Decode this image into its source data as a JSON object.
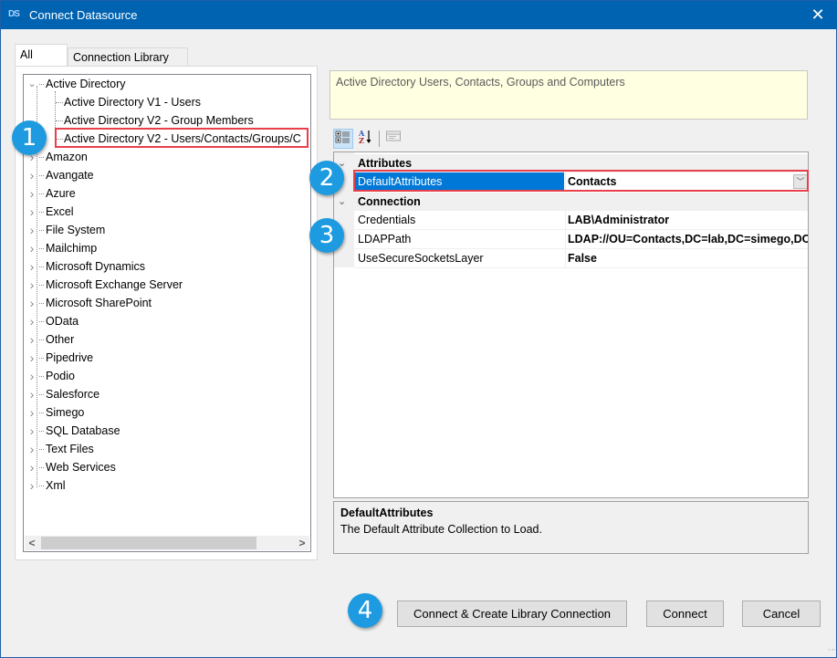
{
  "window": {
    "title": "Connect Datasource",
    "app_icon": "datasync-icon",
    "close_label": "✕"
  },
  "tabs": [
    {
      "label": "All",
      "active": true
    },
    {
      "label": "Connection Library",
      "active": false
    }
  ],
  "tree": {
    "nodes": [
      {
        "label": "Active Directory",
        "expanded": true,
        "children": [
          {
            "label": "Active Directory V1 - Users"
          },
          {
            "label": "Active Directory V2 - Group Members"
          },
          {
            "label": "Active Directory V2 - Users/Contacts/Groups/C",
            "selected": true
          }
        ]
      },
      {
        "label": "Amazon",
        "expanded": false
      },
      {
        "label": "Avangate",
        "expanded": false
      },
      {
        "label": "Azure",
        "expanded": false
      },
      {
        "label": "Excel",
        "expanded": false
      },
      {
        "label": "File System",
        "expanded": false
      },
      {
        "label": "Mailchimp",
        "expanded": false
      },
      {
        "label": "Microsoft Dynamics",
        "expanded": false
      },
      {
        "label": "Microsoft Exchange Server",
        "expanded": false
      },
      {
        "label": "Microsoft SharePoint",
        "expanded": false
      },
      {
        "label": "OData",
        "expanded": false
      },
      {
        "label": "Other",
        "expanded": false
      },
      {
        "label": "Pipedrive",
        "expanded": false
      },
      {
        "label": "Podio",
        "expanded": false
      },
      {
        "label": "Salesforce",
        "expanded": false
      },
      {
        "label": "Simego",
        "expanded": false
      },
      {
        "label": "SQL Database",
        "expanded": false
      },
      {
        "label": "Text Files",
        "expanded": false
      },
      {
        "label": "Web Services",
        "expanded": false
      },
      {
        "label": "Xml",
        "expanded": false
      }
    ],
    "scroll_left_label": "<",
    "scroll_right_label": ">"
  },
  "description": "Active Directory Users, Contacts, Groups and Computers",
  "property_toolbar": {
    "categorized_icon": "categorized-icon",
    "alphabetical_icon": "sort-az-icon",
    "property_pages_icon": "property-pages-icon"
  },
  "property_grid": {
    "categories": [
      {
        "name": "Attributes",
        "properties": [
          {
            "name": "DefaultAttributes",
            "value": "Contacts",
            "selected": true,
            "dropdown": true
          }
        ]
      },
      {
        "name": "Connection",
        "properties": [
          {
            "name": "Credentials",
            "value": "LAB\\Administrator"
          },
          {
            "name": "LDAPPath",
            "value": "LDAP://OU=Contacts,DC=lab,DC=simego,DC=com"
          },
          {
            "name": "UseSecureSocketsLayer",
            "value": "False"
          }
        ]
      }
    ]
  },
  "help": {
    "title": "DefaultAttributes",
    "text": "The Default Attribute Collection to Load."
  },
  "buttons": {
    "connect_create": "Connect & Create Library Connection",
    "connect": "Connect",
    "cancel": "Cancel"
  },
  "callouts": [
    "1",
    "2",
    "3",
    "4"
  ],
  "colors": {
    "titlebar": "#0063b1",
    "selection": "#0078d7",
    "highlight_outline": "#e8404a",
    "callout": "#1e9be0",
    "description_bg": "#ffffe1"
  }
}
